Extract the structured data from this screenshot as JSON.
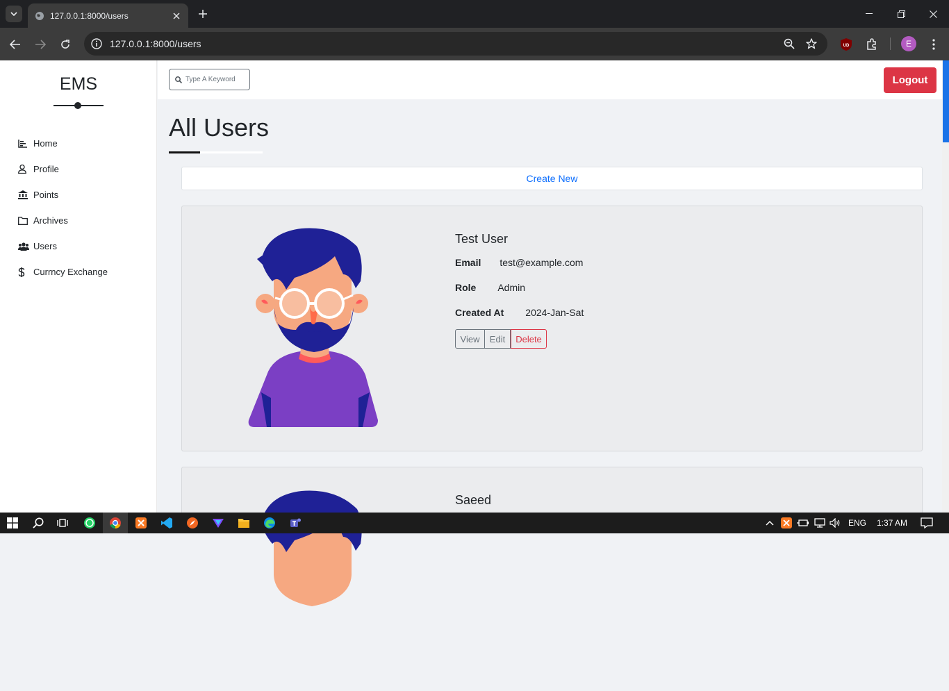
{
  "browser": {
    "tab_title": "127.0.0.1:8000/users",
    "url": "127.0.0.1:8000/users",
    "profile_initial": "E",
    "extension_badge": "UD"
  },
  "sidebar": {
    "brand": "EMS",
    "items": [
      {
        "label": "Home",
        "icon": "chart-bar-icon"
      },
      {
        "label": "Profile",
        "icon": "user-icon"
      },
      {
        "label": "Points",
        "icon": "bank-icon"
      },
      {
        "label": "Archives",
        "icon": "folder-icon"
      },
      {
        "label": "Users",
        "icon": "users-icon"
      },
      {
        "label": "Currncy Exchange",
        "icon": "dollar-icon"
      }
    ]
  },
  "topnav": {
    "search_placeholder": "Type A Keyword",
    "logout_label": "Logout"
  },
  "main": {
    "title": "All Users",
    "create_new_label": "Create New",
    "users": [
      {
        "name": "Test User",
        "email_label": "Email",
        "email": "test@example.com",
        "role_label": "Role",
        "role": "Admin",
        "created_label": "Created At",
        "created": "2024-Jan-Sat",
        "actions": {
          "view": "View",
          "edit": "Edit",
          "delete": "Delete"
        }
      },
      {
        "name": "Saeed"
      }
    ]
  },
  "taskbar": {
    "language": "ENG",
    "time": "1:37 AM"
  },
  "colors": {
    "danger": "#dc3545",
    "primary_link": "#0d6efd",
    "avatar_hair": "#1f2196",
    "avatar_shirt": "#7b3fc4",
    "avatar_skin": "#f6a881"
  }
}
